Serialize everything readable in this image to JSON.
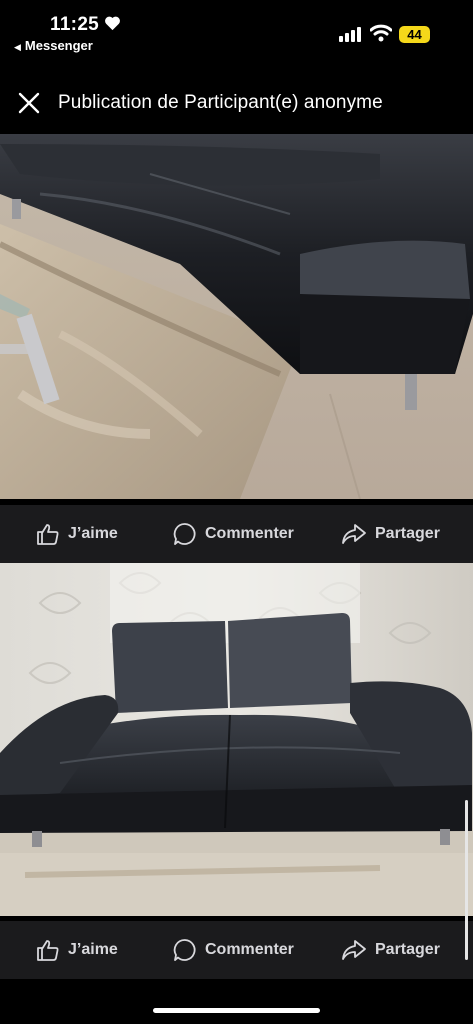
{
  "status_bar": {
    "time": "11:25",
    "back_app": "Messenger",
    "battery": "44",
    "icons": [
      "heart-icon",
      "signal-icon",
      "wifi-icon",
      "battery-icon"
    ]
  },
  "header": {
    "title": "Publication de Participant(e) anonyme",
    "close_icon": "close-icon"
  },
  "posts": [
    {
      "image": "black leather sofa close-up with glass table",
      "actions": {
        "like": "J’aime",
        "comment": "Commenter",
        "share": "Partager"
      }
    },
    {
      "image": "black leather two-seat sofa front view",
      "actions": {
        "like": "J’aime",
        "comment": "Commenter",
        "share": "Partager"
      }
    }
  ],
  "colors": {
    "background": "#000000",
    "action_bar": "#1b1b1d",
    "action_text": "#d8d8dc",
    "battery": "#f5d81a"
  }
}
